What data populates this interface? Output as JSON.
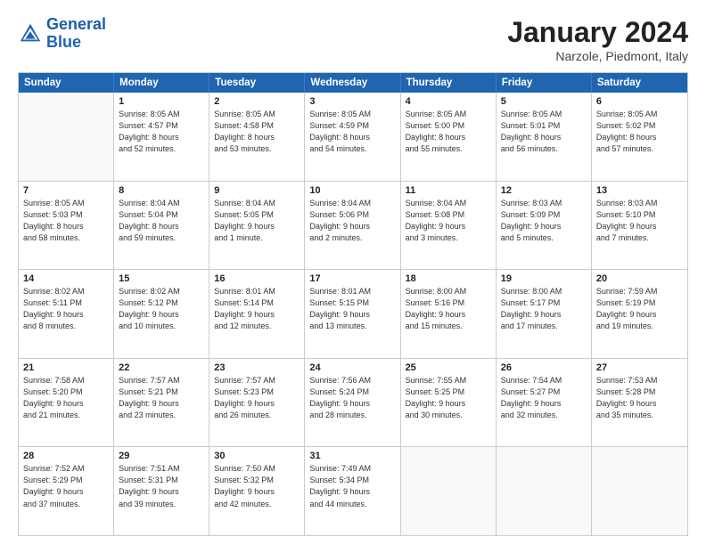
{
  "header": {
    "logo_line1": "General",
    "logo_line2": "Blue",
    "month": "January 2024",
    "location": "Narzole, Piedmont, Italy"
  },
  "days_of_week": [
    "Sunday",
    "Monday",
    "Tuesday",
    "Wednesday",
    "Thursday",
    "Friday",
    "Saturday"
  ],
  "weeks": [
    [
      {
        "day": null,
        "info": null
      },
      {
        "day": "1",
        "info": "Sunrise: 8:05 AM\nSunset: 4:57 PM\nDaylight: 8 hours\nand 52 minutes."
      },
      {
        "day": "2",
        "info": "Sunrise: 8:05 AM\nSunset: 4:58 PM\nDaylight: 8 hours\nand 53 minutes."
      },
      {
        "day": "3",
        "info": "Sunrise: 8:05 AM\nSunset: 4:59 PM\nDaylight: 8 hours\nand 54 minutes."
      },
      {
        "day": "4",
        "info": "Sunrise: 8:05 AM\nSunset: 5:00 PM\nDaylight: 8 hours\nand 55 minutes."
      },
      {
        "day": "5",
        "info": "Sunrise: 8:05 AM\nSunset: 5:01 PM\nDaylight: 8 hours\nand 56 minutes."
      },
      {
        "day": "6",
        "info": "Sunrise: 8:05 AM\nSunset: 5:02 PM\nDaylight: 8 hours\nand 57 minutes."
      }
    ],
    [
      {
        "day": "7",
        "info": "Sunrise: 8:05 AM\nSunset: 5:03 PM\nDaylight: 8 hours\nand 58 minutes."
      },
      {
        "day": "8",
        "info": "Sunrise: 8:04 AM\nSunset: 5:04 PM\nDaylight: 8 hours\nand 59 minutes."
      },
      {
        "day": "9",
        "info": "Sunrise: 8:04 AM\nSunset: 5:05 PM\nDaylight: 9 hours\nand 1 minute."
      },
      {
        "day": "10",
        "info": "Sunrise: 8:04 AM\nSunset: 5:06 PM\nDaylight: 9 hours\nand 2 minutes."
      },
      {
        "day": "11",
        "info": "Sunrise: 8:04 AM\nSunset: 5:08 PM\nDaylight: 9 hours\nand 3 minutes."
      },
      {
        "day": "12",
        "info": "Sunrise: 8:03 AM\nSunset: 5:09 PM\nDaylight: 9 hours\nand 5 minutes."
      },
      {
        "day": "13",
        "info": "Sunrise: 8:03 AM\nSunset: 5:10 PM\nDaylight: 9 hours\nand 7 minutes."
      }
    ],
    [
      {
        "day": "14",
        "info": "Sunrise: 8:02 AM\nSunset: 5:11 PM\nDaylight: 9 hours\nand 8 minutes."
      },
      {
        "day": "15",
        "info": "Sunrise: 8:02 AM\nSunset: 5:12 PM\nDaylight: 9 hours\nand 10 minutes."
      },
      {
        "day": "16",
        "info": "Sunrise: 8:01 AM\nSunset: 5:14 PM\nDaylight: 9 hours\nand 12 minutes."
      },
      {
        "day": "17",
        "info": "Sunrise: 8:01 AM\nSunset: 5:15 PM\nDaylight: 9 hours\nand 13 minutes."
      },
      {
        "day": "18",
        "info": "Sunrise: 8:00 AM\nSunset: 5:16 PM\nDaylight: 9 hours\nand 15 minutes."
      },
      {
        "day": "19",
        "info": "Sunrise: 8:00 AM\nSunset: 5:17 PM\nDaylight: 9 hours\nand 17 minutes."
      },
      {
        "day": "20",
        "info": "Sunrise: 7:59 AM\nSunset: 5:19 PM\nDaylight: 9 hours\nand 19 minutes."
      }
    ],
    [
      {
        "day": "21",
        "info": "Sunrise: 7:58 AM\nSunset: 5:20 PM\nDaylight: 9 hours\nand 21 minutes."
      },
      {
        "day": "22",
        "info": "Sunrise: 7:57 AM\nSunset: 5:21 PM\nDaylight: 9 hours\nand 23 minutes."
      },
      {
        "day": "23",
        "info": "Sunrise: 7:57 AM\nSunset: 5:23 PM\nDaylight: 9 hours\nand 26 minutes."
      },
      {
        "day": "24",
        "info": "Sunrise: 7:56 AM\nSunset: 5:24 PM\nDaylight: 9 hours\nand 28 minutes."
      },
      {
        "day": "25",
        "info": "Sunrise: 7:55 AM\nSunset: 5:25 PM\nDaylight: 9 hours\nand 30 minutes."
      },
      {
        "day": "26",
        "info": "Sunrise: 7:54 AM\nSunset: 5:27 PM\nDaylight: 9 hours\nand 32 minutes."
      },
      {
        "day": "27",
        "info": "Sunrise: 7:53 AM\nSunset: 5:28 PM\nDaylight: 9 hours\nand 35 minutes."
      }
    ],
    [
      {
        "day": "28",
        "info": "Sunrise: 7:52 AM\nSunset: 5:29 PM\nDaylight: 9 hours\nand 37 minutes."
      },
      {
        "day": "29",
        "info": "Sunrise: 7:51 AM\nSunset: 5:31 PM\nDaylight: 9 hours\nand 39 minutes."
      },
      {
        "day": "30",
        "info": "Sunrise: 7:50 AM\nSunset: 5:32 PM\nDaylight: 9 hours\nand 42 minutes."
      },
      {
        "day": "31",
        "info": "Sunrise: 7:49 AM\nSunset: 5:34 PM\nDaylight: 9 hours\nand 44 minutes."
      },
      {
        "day": null,
        "info": null
      },
      {
        "day": null,
        "info": null
      },
      {
        "day": null,
        "info": null
      }
    ]
  ]
}
